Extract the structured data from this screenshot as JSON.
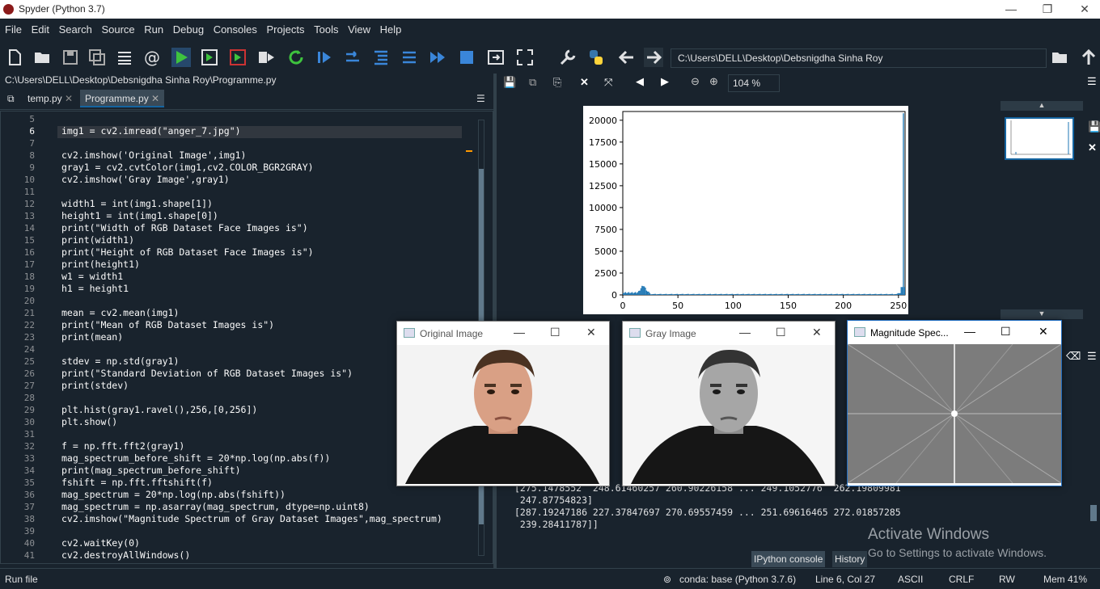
{
  "window": {
    "title": "Spyder (Python 3.7)"
  },
  "menu": [
    "File",
    "Edit",
    "Search",
    "Source",
    "Run",
    "Debug",
    "Consoles",
    "Projects",
    "Tools",
    "View",
    "Help"
  ],
  "toolbar": {
    "path": "C:\\Users\\DELL\\Desktop\\Debsnigdha Sinha Roy"
  },
  "editor": {
    "file_path": "C:\\Users\\DELL\\Desktop\\Debsnigdha Sinha Roy\\Programme.py",
    "tabs": [
      {
        "label": "temp.py"
      },
      {
        "label": "Programme.py"
      }
    ],
    "lines": [
      {
        "n": "5",
        "code": ""
      },
      {
        "n": "6",
        "code": "img1 = cv2.imread(\"anger_7.jpg\")"
      },
      {
        "n": "7",
        "code": ""
      },
      {
        "n": "8",
        "code": "cv2.imshow('Original Image',img1)"
      },
      {
        "n": "9",
        "code": "gray1 = cv2.cvtColor(img1,cv2.COLOR_BGR2GRAY)"
      },
      {
        "n": "10",
        "code": "cv2.imshow('Gray Image',gray1)"
      },
      {
        "n": "11",
        "code": ""
      },
      {
        "n": "12",
        "code": "width1 = int(img1.shape[1])"
      },
      {
        "n": "13",
        "code": "height1 = int(img1.shape[0])"
      },
      {
        "n": "14",
        "code": "print(\"Width of RGB Dataset Face Images is\")"
      },
      {
        "n": "15",
        "code": "print(width1)"
      },
      {
        "n": "16",
        "code": "print(\"Height of RGB Dataset Face Images is\")"
      },
      {
        "n": "17",
        "code": "print(height1)"
      },
      {
        "n": "18",
        "code": "w1 = width1"
      },
      {
        "n": "19",
        "code": "h1 = height1"
      },
      {
        "n": "20",
        "code": ""
      },
      {
        "n": "21",
        "code": "mean = cv2.mean(img1)"
      },
      {
        "n": "22",
        "code": "print(\"Mean of RGB Dataset Images is\")"
      },
      {
        "n": "23",
        "code": "print(mean)"
      },
      {
        "n": "24",
        "code": ""
      },
      {
        "n": "25",
        "code": "stdev = np.std(gray1)"
      },
      {
        "n": "26",
        "code": "print(\"Standard Deviation of RGB Dataset Images is\")"
      },
      {
        "n": "27",
        "code": "print(stdev)"
      },
      {
        "n": "28",
        "code": ""
      },
      {
        "n": "29",
        "code": "plt.hist(gray1.ravel(),256,[0,256])"
      },
      {
        "n": "30",
        "code": "plt.show()"
      },
      {
        "n": "31",
        "code": ""
      },
      {
        "n": "32",
        "code": "f = np.fft.fft2(gray1)"
      },
      {
        "n": "33",
        "code": "mag_spectrum_before_shift = 20*np.log(np.abs(f))"
      },
      {
        "n": "34",
        "code": "print(mag_spectrum_before_shift)"
      },
      {
        "n": "35",
        "code": "fshift = np.fft.fftshift(f)"
      },
      {
        "n": "36",
        "code": "mag_spectrum = 20*np.log(np.abs(fshift))"
      },
      {
        "n": "37",
        "code": "mag_spectrum = np.asarray(mag_spectrum, dtype=np.uint8)"
      },
      {
        "n": "38",
        "code": "cv2.imshow(\"Magnitude Spectrum of Gray Dataset Images\",mag_spectrum)"
      },
      {
        "n": "39",
        "code": ""
      },
      {
        "n": "40",
        "code": "cv2.waitKey(0)"
      },
      {
        "n": "41",
        "code": "cv2.destroyAllWindows()"
      }
    ]
  },
  "plots": {
    "zoom": "104 %",
    "chart_data": {
      "type": "bar",
      "x_ticks": [
        "0",
        "50",
        "100",
        "150",
        "200",
        "250"
      ],
      "y_ticks": [
        "0",
        "2500",
        "5000",
        "7500",
        "10000",
        "12500",
        "15000",
        "17500",
        "20000"
      ],
      "xlim": [
        0,
        256
      ],
      "ylim": [
        0,
        21000
      ],
      "peaks": [
        {
          "x": 18,
          "y": 1200
        },
        {
          "x": 254,
          "y": 20800
        }
      ]
    }
  },
  "console": {
    "lines": [
      "[275.1478552  248.61460257 260.90226158 ... 249.1052776  262.19809981",
      " 247.87754823]",
      "[287.19247186 227.37847697 270.69557459 ... 251.69616465 272.01857285",
      " 239.28411787]]"
    ],
    "tabs": [
      {
        "label": "IPython console"
      },
      {
        "label": "History"
      }
    ]
  },
  "windows": [
    {
      "title": "Original Image"
    },
    {
      "title": "Gray Image"
    },
    {
      "title": "Magnitude Spec..."
    }
  ],
  "watermark": {
    "line1": "Activate Windows",
    "line2": "Go to Settings to activate Windows."
  },
  "status": {
    "left": "Run file",
    "env": "conda: base (Python 3.7.6)",
    "cursor": "Line 6, Col 27",
    "encoding": "ASCII",
    "eol": "CRLF",
    "perm": "RW",
    "mem": "Mem 41%"
  }
}
